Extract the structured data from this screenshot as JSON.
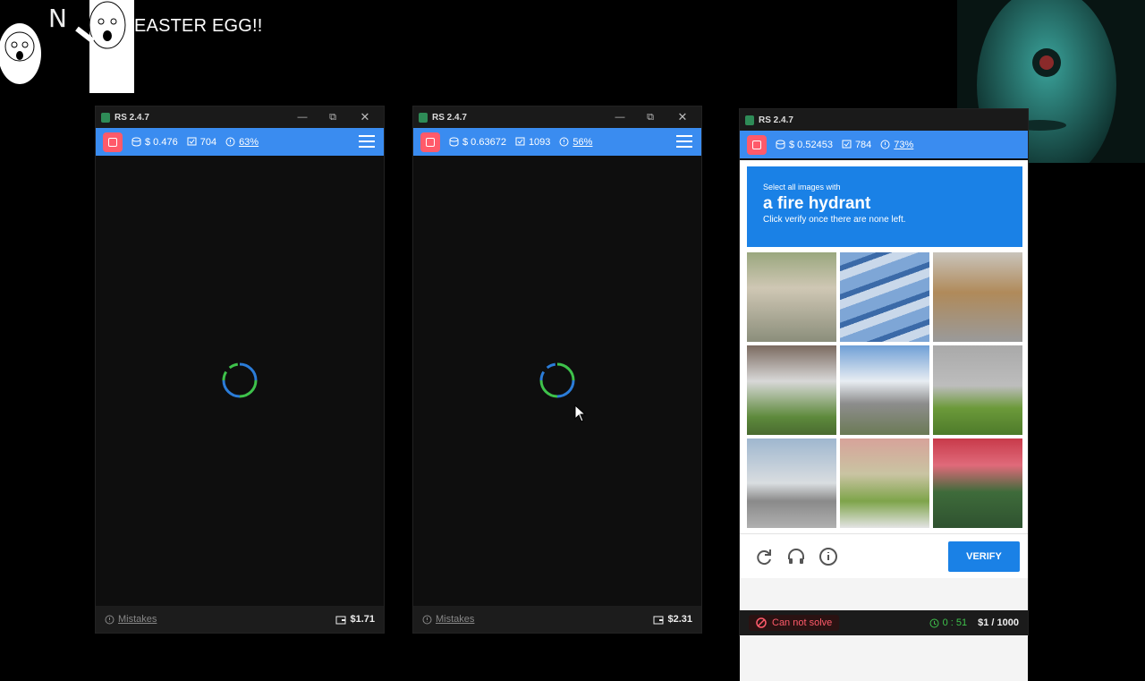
{
  "overlay": {
    "letter": "N",
    "caption": "EASTER EGG!!"
  },
  "windows": [
    {
      "title": "RS 2.4.7",
      "balance": "$ 0.476",
      "count": "704",
      "rate": "63%",
      "mistakes": "Mistakes",
      "wallet": "$1.71"
    },
    {
      "title": "RS 2.4.7",
      "balance": "$ 0.63672",
      "count": "1093",
      "rate": "56%",
      "mistakes": "Mistakes",
      "wallet": "$2.31"
    },
    {
      "title": "RS 2.4.7",
      "balance": "$ 0.52453",
      "count": "784",
      "rate": "73%"
    }
  ],
  "captcha": {
    "line1": "Select all images with",
    "line2": "a fire hydrant",
    "line3": "Click verify once there are none left.",
    "verify": "VERIFY",
    "cannot_solve": "Can not solve",
    "timer": "0 : 51",
    "progress": "$1 / 1000"
  },
  "colors": {
    "accent": "#3a8cf0",
    "stop": "#ff5a6a",
    "captcha_blue": "#1a81e6",
    "timer": "#3ec24b"
  }
}
